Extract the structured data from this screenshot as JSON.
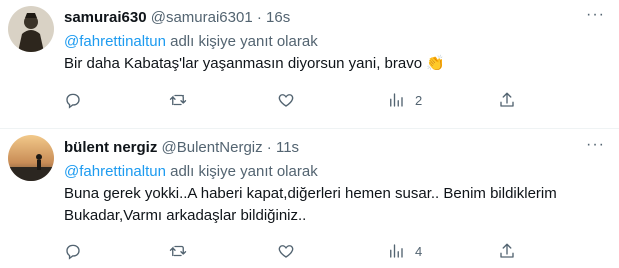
{
  "tweets": [
    {
      "name": "samurai630",
      "handle": "@samurai6301",
      "sep": "·",
      "time": "16s",
      "reply_mention": "@fahrettinaltun",
      "reply_text": " adlı kişiye yanıt olarak",
      "body": "Bir daha Kabataş'lar yaşanmasın diyorsun yani, bravo 👏",
      "views": "2",
      "more_icon": "more-dots-icon"
    },
    {
      "name": "bülent nergiz",
      "handle": "@BulentNergiz",
      "sep": "·",
      "time": "11s",
      "reply_mention": "@fahrettinaltun",
      "reply_text": " adlı kişiye yanıt olarak",
      "body_line1": "Buna gerek yokki..A haberi kapat,diğerleri hemen susar.. Benim bildiklerim",
      "body_line2": "Bukadar,Varmı arkadaşlar bildiğiniz..",
      "views": "4",
      "more_icon": "more-dots-icon"
    }
  ],
  "icons": [
    "reply-icon",
    "retweet-icon",
    "like-icon",
    "views-icon",
    "share-icon"
  ],
  "colors": {
    "link": "#1d9bf0",
    "secondary": "#536471",
    "text": "#0f1419",
    "divider": "#eff3f4"
  }
}
